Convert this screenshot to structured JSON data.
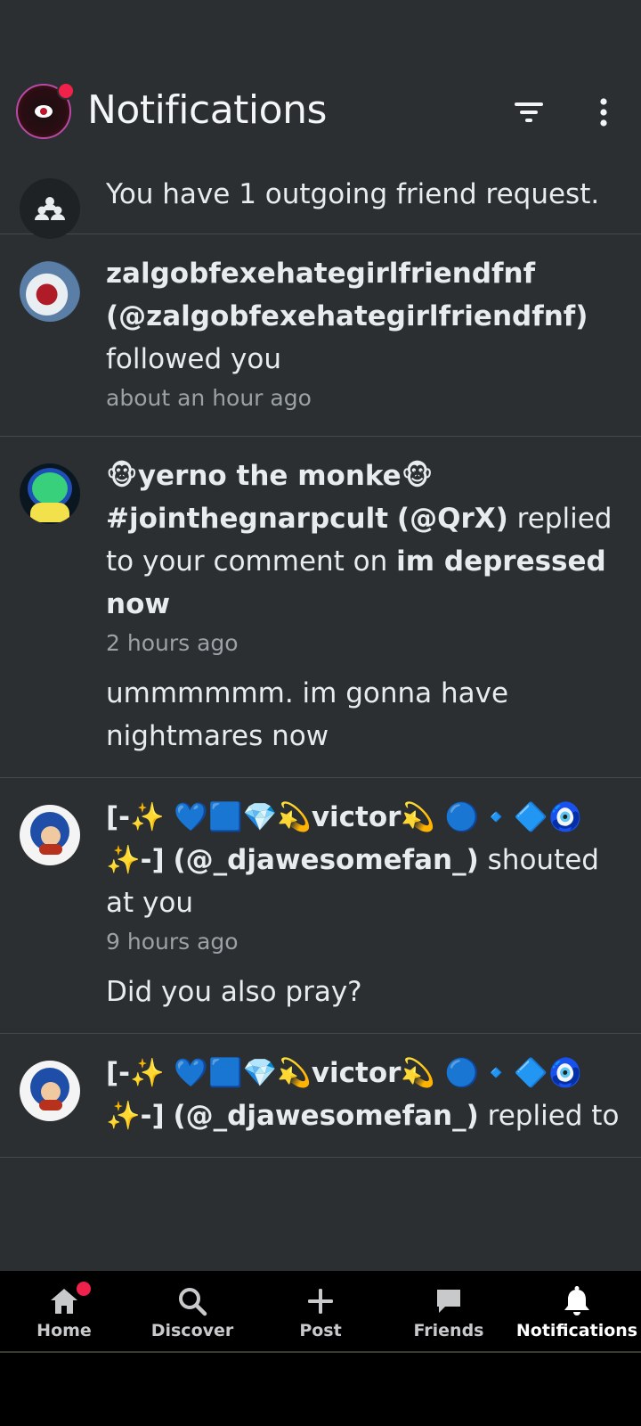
{
  "header": {
    "title": "Notifications",
    "filter_icon": "filter-icon",
    "more_icon": "more-vertical-icon"
  },
  "friend_request": {
    "text": "You have 1 outgoing friend request."
  },
  "notifications": [
    {
      "name": "zalgobfexehategirlfriendfnf",
      "handle": "(@zalgobfexehategirlfriendfnf)",
      "action": "followed you",
      "time": "about an hour ago"
    },
    {
      "name": "🐵yerno the monke🐵 #jointhegnarpcult",
      "handle": "(@QrX)",
      "action": "replied to your comment on",
      "post_title": "im depressed now",
      "time": "2 hours ago",
      "snippet": "ummmmmm. im gonna have nightmares now"
    },
    {
      "name": "[-✨ 💙🟦💎💫victor💫 🔵🔹🔷🧿✨-]",
      "handle": "(@_djawesomefan_)",
      "action": "shouted at you",
      "time": "9 hours ago",
      "snippet": "Did you also pray?"
    },
    {
      "name": "[-✨ 💙🟦💎💫victor💫 🔵🔹🔷🧿✨-]",
      "handle": "(@_djawesomefan_)",
      "action": "replied to"
    }
  ],
  "nav": {
    "home": "Home",
    "discover": "Discover",
    "post": "Post",
    "friends": "Friends",
    "notifications": "Notifications"
  },
  "colors": {
    "background": "#2b2f31",
    "badge": "#f0224c",
    "nav_background": "#000000"
  }
}
